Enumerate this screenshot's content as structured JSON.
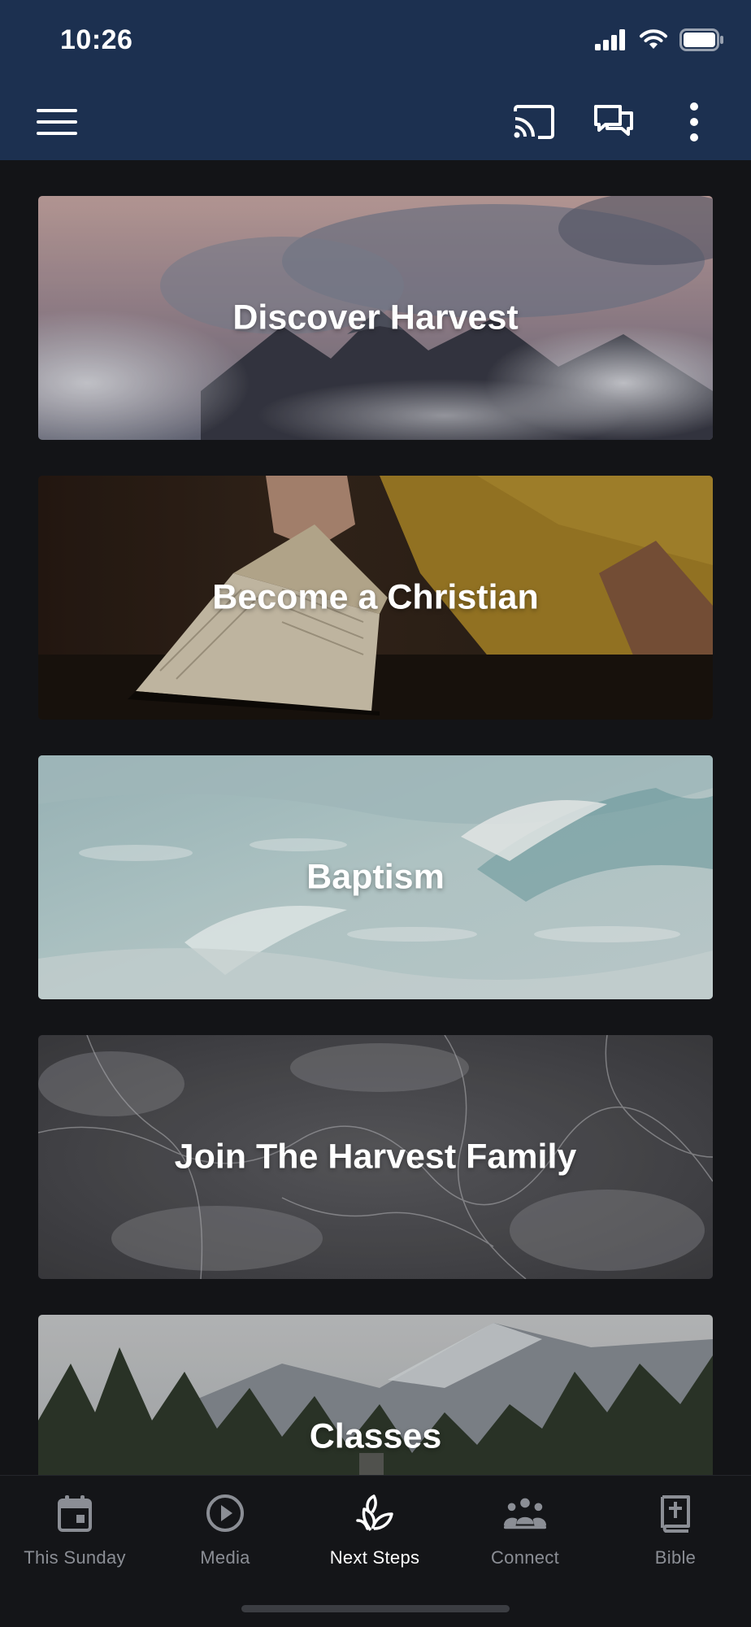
{
  "status_bar": {
    "time": "10:26"
  },
  "app_bar": {
    "icons": [
      "menu-icon",
      "cast-icon",
      "chat-icon",
      "more-vertical-icon"
    ]
  },
  "cards": [
    {
      "title": "Discover Harvest"
    },
    {
      "title": "Become a Christian"
    },
    {
      "title": "Baptism"
    },
    {
      "title": "Join The Harvest Family"
    },
    {
      "title": "Classes"
    }
  ],
  "tab_bar": {
    "active": "Next Steps",
    "items": [
      {
        "label": "This Sunday",
        "icon": "calendar-icon"
      },
      {
        "label": "Media",
        "icon": "play-circle-icon"
      },
      {
        "label": "Next Steps",
        "icon": "sprout-icon"
      },
      {
        "label": "Connect",
        "icon": "group-icon"
      },
      {
        "label": "Bible",
        "icon": "bible-icon"
      }
    ]
  },
  "colors": {
    "header": "#1c3050",
    "background": "#131417",
    "tab_active": "#ffffff",
    "tab_inactive": "#8b8e95"
  }
}
